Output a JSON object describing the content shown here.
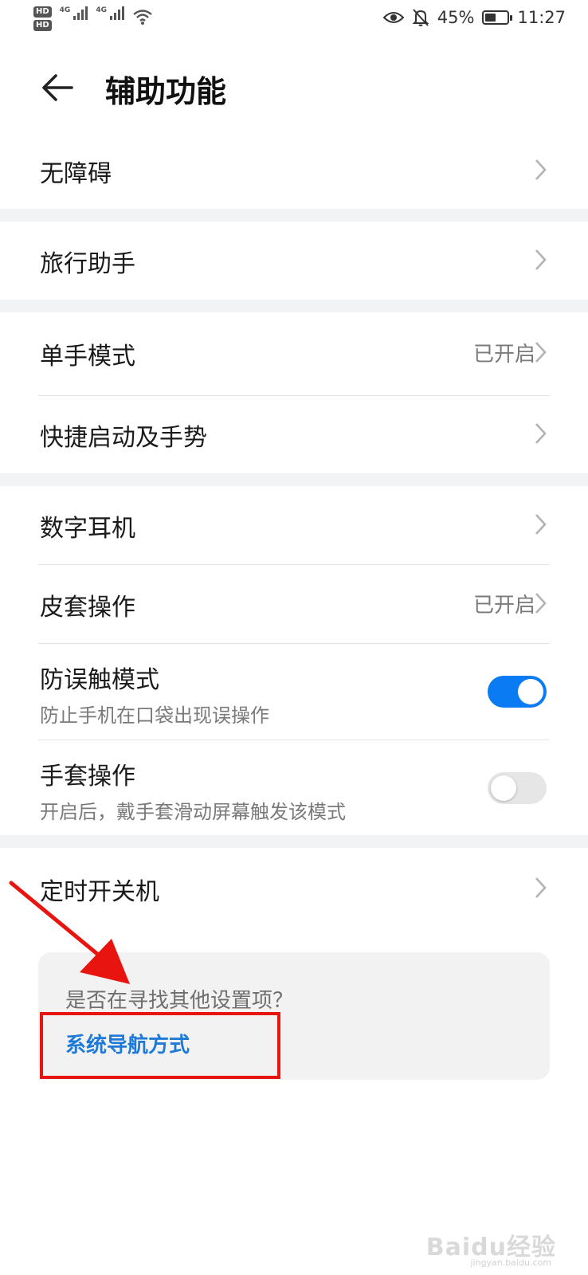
{
  "status_bar": {
    "hd1": "HD",
    "hd2": "HD",
    "sim1": "4G",
    "sim2": "4G",
    "battery_percent": "45%",
    "battery_level": 0.45,
    "time": "11:27",
    "icons": [
      "eye-comfort-icon",
      "bell-muted-icon",
      "battery-icon",
      "wifi-icon",
      "signal-icon"
    ]
  },
  "header": {
    "title": "辅助功能",
    "back_icon": "back-arrow-icon"
  },
  "items": [
    {
      "label": "无障碍"
    },
    {
      "label": "旅行助手"
    },
    {
      "label": "单手模式",
      "value": "已开启"
    },
    {
      "label": "快捷启动及手势"
    },
    {
      "label": "数字耳机"
    },
    {
      "label": "皮套操作",
      "value": "已开启"
    },
    {
      "label": "防误触模式",
      "sub": "防止手机在口袋出现误操作",
      "toggle": true
    },
    {
      "label": "手套操作",
      "sub": "开启后，戴手套滑动屏幕触发该模式",
      "toggle": false
    },
    {
      "label": "定时开关机"
    }
  ],
  "suggestion": {
    "question": "是否在寻找其他设置项？",
    "link": "系统导航方式"
  },
  "watermark": {
    "brand": "Baidu经验",
    "url": "jingyan.baidu.com"
  },
  "colors": {
    "accent": "#0a7bf2",
    "link": "#1e7ad6",
    "highlight": "#e8140f",
    "section_gap": "#f1f3f5"
  }
}
